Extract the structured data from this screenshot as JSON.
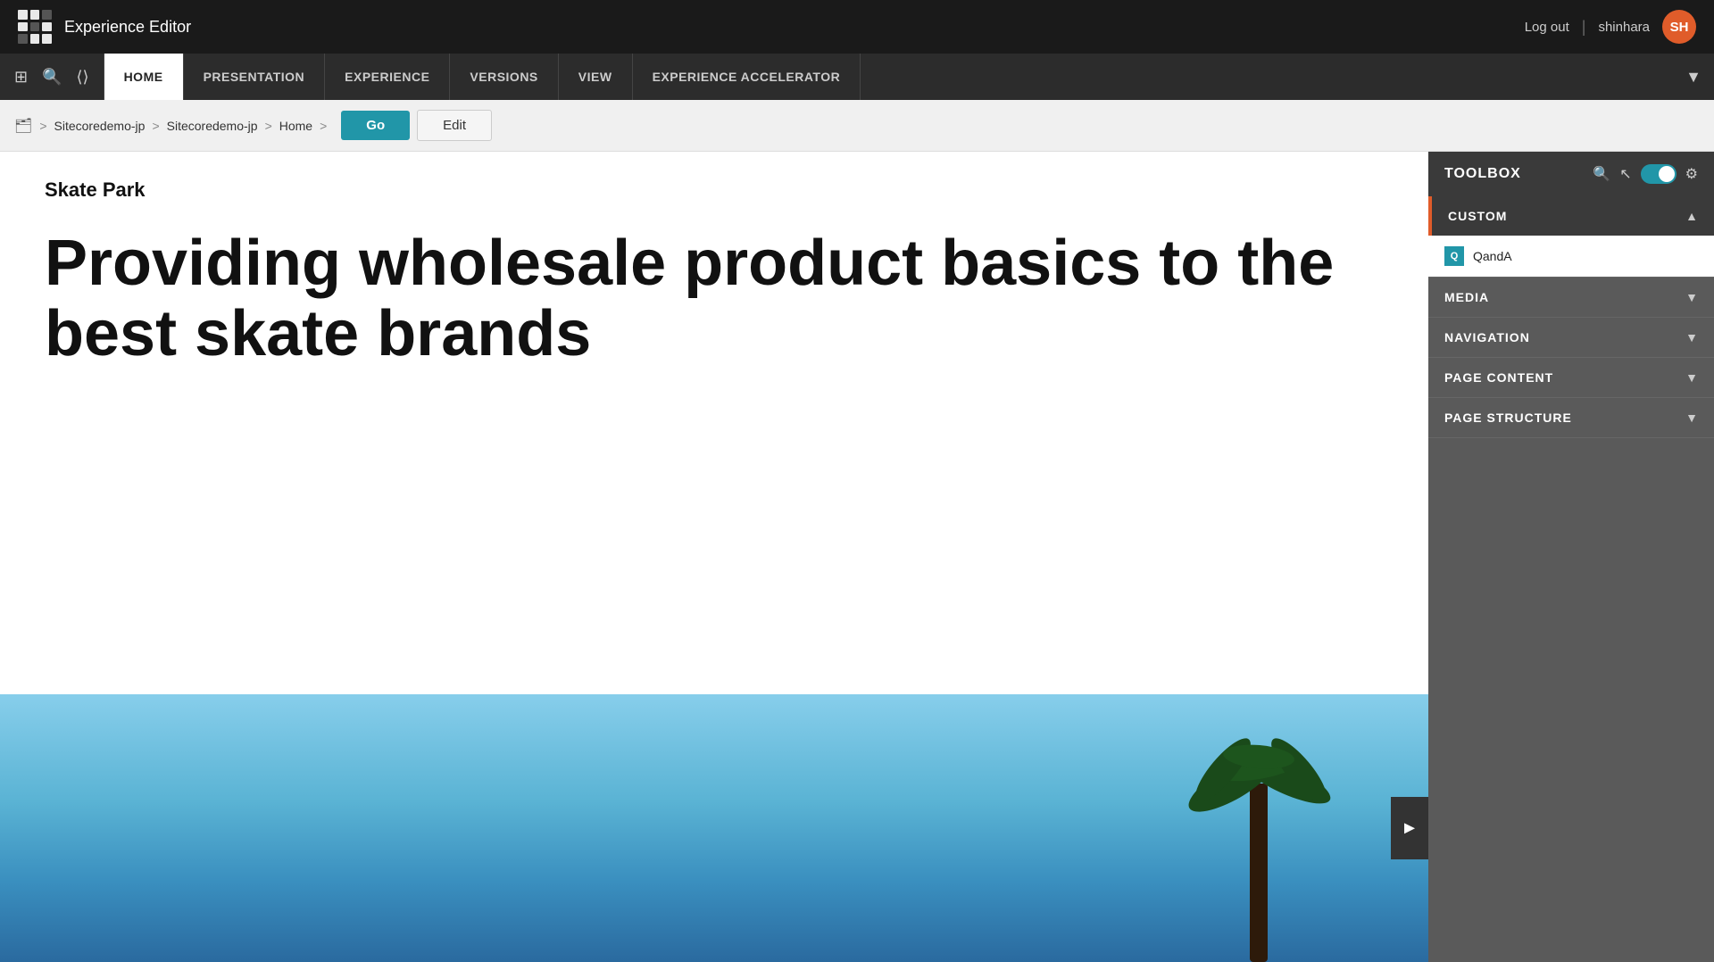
{
  "app": {
    "title": "Experience Editor",
    "logo_cells": 9
  },
  "topbar": {
    "logout_label": "Log out",
    "separator": "|",
    "username": "shinhara",
    "avatar_initials": "SH",
    "avatar_color": "#e05c2a"
  },
  "navbar": {
    "icons": [
      "home-icon",
      "search-icon",
      "share-icon"
    ],
    "items": [
      {
        "label": "HOME",
        "active": true
      },
      {
        "label": "PRESENTATION",
        "active": false
      },
      {
        "label": "EXPERIENCE",
        "active": false
      },
      {
        "label": "VERSIONS",
        "active": false
      },
      {
        "label": "VIEW",
        "active": false
      },
      {
        "label": "EXPERIENCE ACCELERATOR",
        "active": false
      }
    ]
  },
  "breadcrumb": {
    "icon": "🏠",
    "parts": [
      "Sitecoredemo-jp",
      "Sitecoredemo-jp",
      "Home"
    ],
    "go_label": "Go",
    "edit_label": "Edit"
  },
  "content": {
    "page_subtitle": "Skate Park",
    "hero_text": "Providing wholesale product basics to the best skate brands"
  },
  "toolbox": {
    "title": "TOOLBOX",
    "sections": [
      {
        "label": "CUSTOM",
        "expanded": true,
        "accent": true,
        "items": [
          {
            "id": "qanda",
            "label": "QandA",
            "icon_text": "Q"
          }
        ]
      },
      {
        "label": "MEDIA",
        "expanded": false
      },
      {
        "label": "NAVIGATION",
        "expanded": false
      },
      {
        "label": "PAGE CONTENT",
        "expanded": false
      },
      {
        "label": "PAGE STRUCTURE",
        "expanded": false
      }
    ]
  }
}
